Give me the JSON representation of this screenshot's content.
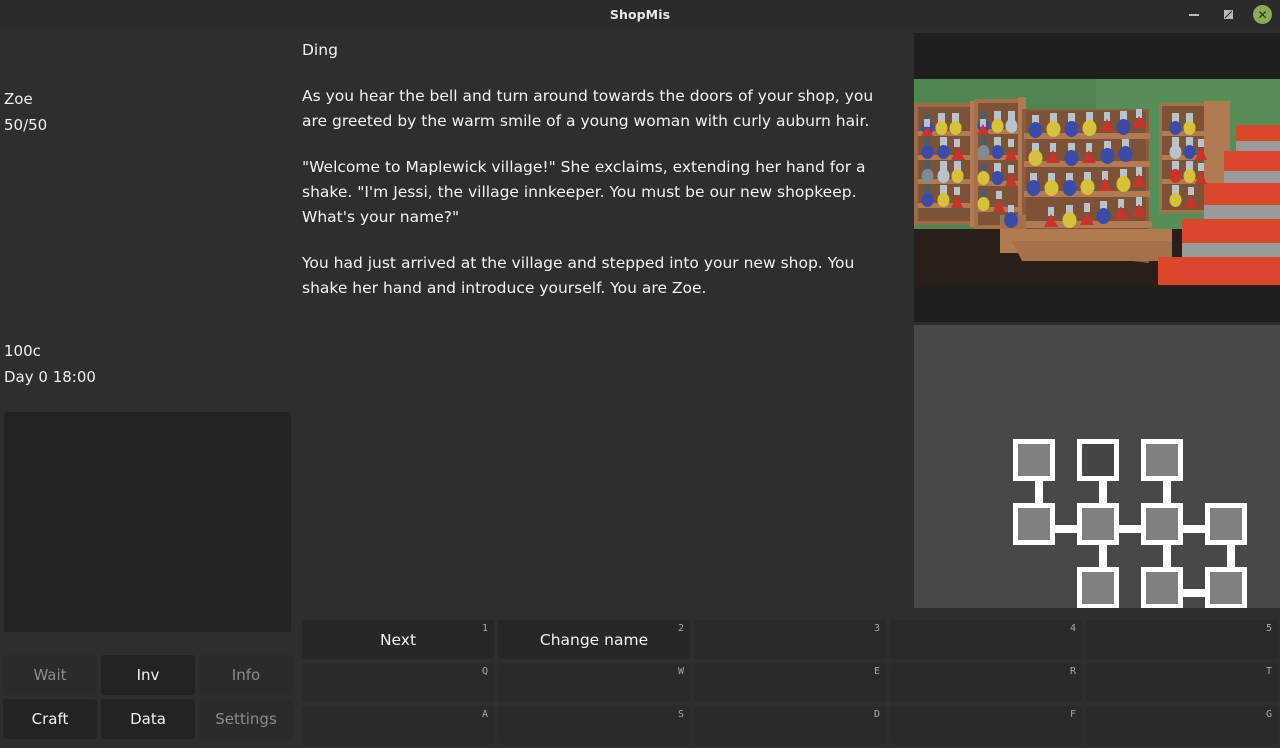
{
  "window": {
    "title": "ShopMis",
    "minimize_label": "minimize",
    "maximize_label": "maximize",
    "close_label": "✕",
    "close_color": "#8bab54"
  },
  "sidebar": {
    "player": {
      "name": "Zoe",
      "hp": "50/50"
    },
    "economy": {
      "money": "100c",
      "time": "Day 0 18:00"
    },
    "menu_buttons": [
      {
        "label": "Wait",
        "enabled": false
      },
      {
        "label": "Inv",
        "enabled": true
      },
      {
        "label": "Info",
        "enabled": false
      },
      {
        "label": "Craft",
        "enabled": true
      },
      {
        "label": "Data",
        "enabled": true
      },
      {
        "label": "Settings",
        "enabled": false
      }
    ]
  },
  "story": {
    "paragraphs": [
      "Ding",
      "As you hear the bell and turn around towards the doors of your shop, you are greeted by the warm smile of a young woman with curly auburn hair.",
      "\"Welcome to Maplewick village!\" She exclaims, extending her hand for a shake. \"I'm Jessi, the village innkeeper. You must be our new shopkeep. What's your name?\"",
      "You had just arrived at the village and stepped into your new shop. You shake her hand and introduce yourself. You are Zoe."
    ]
  },
  "scene": {
    "name": "potion-shop-interior",
    "wall_color": "#4f8751",
    "floor_color": "#2b1f1c",
    "shelf_color": "#b07a52",
    "stair_riser_color": "#d9482a",
    "stair_tread_color": "#9a9a9a",
    "potion_colors": [
      "#3a4ba8",
      "#d6c23a",
      "#c8342b",
      "#b9c3cc"
    ]
  },
  "map": {
    "node_color": "#808080",
    "unvisited_color": "#454545",
    "edge_color": "#ffffff",
    "nodes": [
      {
        "col": 0,
        "row": 0,
        "visited": true
      },
      {
        "col": 1,
        "row": 0,
        "visited": false
      },
      {
        "col": 2,
        "row": 0,
        "visited": true
      },
      {
        "col": 0,
        "row": 1,
        "visited": true
      },
      {
        "col": 1,
        "row": 1,
        "visited": true
      },
      {
        "col": 2,
        "row": 1,
        "visited": true
      },
      {
        "col": 3,
        "row": 1,
        "visited": true
      },
      {
        "col": 1,
        "row": 2,
        "visited": true
      },
      {
        "col": 2,
        "row": 2,
        "visited": true
      },
      {
        "col": 3,
        "row": 2,
        "visited": true
      }
    ],
    "edges": [
      {
        "from": [
          0,
          0
        ],
        "to": [
          0,
          1
        ]
      },
      {
        "from": [
          1,
          0
        ],
        "to": [
          1,
          1
        ]
      },
      {
        "from": [
          2,
          0
        ],
        "to": [
          2,
          1
        ]
      },
      {
        "from": [
          0,
          1
        ],
        "to": [
          1,
          1
        ]
      },
      {
        "from": [
          1,
          1
        ],
        "to": [
          2,
          1
        ]
      },
      {
        "from": [
          2,
          1
        ],
        "to": [
          3,
          1
        ]
      },
      {
        "from": [
          1,
          1
        ],
        "to": [
          1,
          2
        ]
      },
      {
        "from": [
          2,
          1
        ],
        "to": [
          2,
          2
        ]
      },
      {
        "from": [
          3,
          1
        ],
        "to": [
          3,
          2
        ]
      },
      {
        "from": [
          2,
          2
        ],
        "to": [
          3,
          2
        ]
      }
    ]
  },
  "actions": {
    "cells": [
      {
        "label": "Next",
        "key": "1"
      },
      {
        "label": "Change name",
        "key": "2"
      },
      {
        "label": "",
        "key": "3"
      },
      {
        "label": "",
        "key": "4"
      },
      {
        "label": "",
        "key": "5"
      },
      {
        "label": "",
        "key": "Q"
      },
      {
        "label": "",
        "key": "W"
      },
      {
        "label": "",
        "key": "E"
      },
      {
        "label": "",
        "key": "R"
      },
      {
        "label": "",
        "key": "T"
      },
      {
        "label": "",
        "key": "A"
      },
      {
        "label": "",
        "key": "S"
      },
      {
        "label": "",
        "key": "D"
      },
      {
        "label": "",
        "key": "F"
      },
      {
        "label": "",
        "key": "G"
      }
    ]
  }
}
